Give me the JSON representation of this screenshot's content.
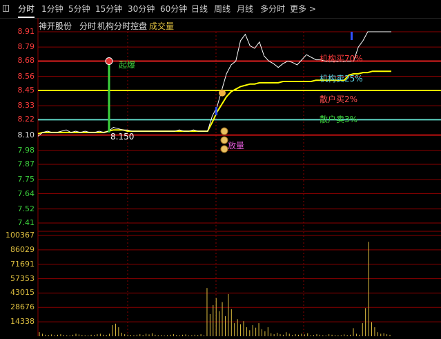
{
  "topbar": {
    "tabs": [
      "分时",
      "1分钟",
      "5分钟",
      "15分钟",
      "30分钟",
      "60分钟",
      "日线",
      "周线",
      "月线",
      "多分时"
    ],
    "more": "更多",
    "more_icon": "chevron-right-icon"
  },
  "header": {
    "stock_name": "神开股份",
    "mode": "分时",
    "indicator": "机构分时控盘",
    "volume_label": "成交量"
  },
  "price_axis": {
    "labels": [
      "8.91",
      "8.79",
      "8.68",
      "8.56",
      "8.45",
      "8.33",
      "8.22",
      "8.10",
      "7.98",
      "7.87",
      "7.75",
      "7.64",
      "7.52",
      "7.41"
    ]
  },
  "volume_axis": {
    "labels": [
      "100367",
      "86029",
      "71691",
      "57353",
      "43015",
      "28676",
      "14338"
    ]
  },
  "annotations": {
    "surge": "起爆",
    "surge_price": "8.150",
    "volume_surge": "放量",
    "inst_buy": "机构买70%",
    "inst_sell": "机构卖25%",
    "retail_buy": "散户买2%",
    "retail_sell": "散户卖3%"
  },
  "colors": {
    "up": "#ff3c3c",
    "down": "#3cd23c",
    "price_line": "#ffffff",
    "avg_line": "#ffff00",
    "inst_sell_line": "#5fd8c8",
    "grid": "#8b0000"
  },
  "chart_data": {
    "type": "line",
    "title": "",
    "price": {
      "ylim": [
        7.41,
        8.91
      ],
      "reference_lines": {
        "inst_buy": 8.68,
        "retail_buy": 8.45,
        "inst_sell": 8.22,
        "base": 8.1
      },
      "series": [
        {
          "values": [
            8.09,
            8.12,
            8.13,
            8.12,
            8.12,
            8.13,
            8.14,
            8.12,
            8.13,
            8.12,
            8.13,
            8.12,
            8.12,
            8.13,
            8.12,
            8.13,
            8.16,
            8.15,
            8.14,
            8.14,
            8.13,
            8.13,
            8.13,
            8.13,
            8.13,
            8.13,
            8.13,
            8.13,
            8.13,
            8.13,
            8.14,
            8.13,
            8.13,
            8.14,
            8.13,
            8.13,
            8.13,
            8.25,
            8.32,
            8.45,
            8.58,
            8.65,
            8.68,
            8.84,
            8.89,
            8.8,
            8.78,
            8.83,
            8.72,
            8.68,
            8.66,
            8.63,
            8.66,
            8.68,
            8.67,
            8.65,
            8.69,
            8.73,
            8.71,
            8.69,
            8.69,
            8.68,
            8.68,
            8.68,
            8.68,
            8.68,
            8.68,
            8.68,
            8.79,
            8.84,
            8.91,
            8.91,
            8.91,
            8.91,
            8.91,
            8.91
          ]
        },
        {
          "values": [
            8.11,
            8.12,
            8.12,
            8.12,
            8.12,
            8.12,
            8.12,
            8.12,
            8.12,
            8.12,
            8.12,
            8.12,
            8.12,
            8.12,
            8.12,
            8.13,
            8.14,
            8.14,
            8.14,
            8.13,
            8.13,
            8.13,
            8.13,
            8.13,
            8.13,
            8.13,
            8.13,
            8.13,
            8.13,
            8.13,
            8.13,
            8.13,
            8.13,
            8.13,
            8.13,
            8.13,
            8.13,
            8.2,
            8.28,
            8.34,
            8.4,
            8.44,
            8.46,
            8.48,
            8.49,
            8.5,
            8.5,
            8.51,
            8.51,
            8.51,
            8.51,
            8.51,
            8.52,
            8.52,
            8.52,
            8.52,
            8.52,
            8.52,
            8.52,
            8.53,
            8.53,
            8.53,
            8.53,
            8.53,
            8.53,
            8.53,
            8.57,
            8.58,
            8.58,
            8.59,
            8.59,
            8.6,
            8.6,
            8.6,
            8.6,
            8.6
          ]
        }
      ]
    },
    "volume": {
      "ylim": [
        0,
        100367
      ],
      "values": [
        4000,
        2500,
        1500,
        1200,
        1800,
        1000,
        1500,
        2000,
        1200,
        1000,
        800,
        1500,
        2500,
        1800,
        1200,
        1000,
        900,
        1500,
        1200,
        2000,
        2500,
        1500,
        1200,
        2500,
        11000,
        12500,
        9000,
        3500,
        2000,
        1500,
        1200,
        1000,
        1500,
        2000,
        1200,
        2500,
        1800,
        3000,
        1500,
        1000,
        1200,
        800,
        1000,
        1500,
        2000,
        1200,
        1000,
        1500,
        1800,
        800,
        1000,
        1500,
        1200,
        2000,
        1000,
        48000,
        22000,
        31000,
        38000,
        25000,
        34000,
        20000,
        42000,
        27000,
        13000,
        17000,
        12000,
        15000,
        9000,
        6000,
        11000,
        8500,
        13000,
        7000,
        5000,
        9000,
        3000,
        2000,
        3500,
        2000,
        1500,
        4000,
        2500,
        1200,
        2000,
        1500,
        2500,
        1800,
        3000,
        1000,
        1200,
        2000,
        1500,
        1000,
        800,
        2000,
        1500,
        1200,
        1000,
        1000,
        1800,
        1200,
        1500,
        8000,
        2500,
        1500,
        13000,
        28000,
        94000,
        14000,
        9000,
        4000,
        2500,
        3000,
        2000,
        1500
      ]
    }
  }
}
